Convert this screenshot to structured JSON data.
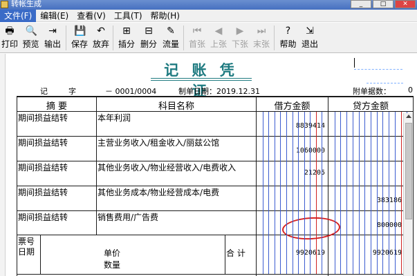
{
  "window": {
    "title": "转帐生成"
  },
  "menu": [
    "文件(F)",
    "编辑(E)",
    "查看(V)",
    "工具(T)",
    "帮助(H)"
  ],
  "toolbar": [
    {
      "label": "打印",
      "icon": "print-icon",
      "glyph": "🖶",
      "enabled": true
    },
    {
      "label": "预览",
      "icon": "preview-icon",
      "glyph": "🔍",
      "enabled": true
    },
    {
      "label": "输出",
      "icon": "export-icon",
      "glyph": "⇥",
      "enabled": true
    },
    {
      "label": "保存",
      "icon": "save-icon",
      "glyph": "💾",
      "enabled": true
    },
    {
      "label": "放弃",
      "icon": "undo-icon",
      "glyph": "↶",
      "enabled": true
    },
    {
      "label": "插分",
      "icon": "insert-entry-icon",
      "glyph": "⊞",
      "enabled": true
    },
    {
      "label": "删分",
      "icon": "delete-entry-icon",
      "glyph": "⊟",
      "enabled": true
    },
    {
      "label": "流量",
      "icon": "cashflow-icon",
      "glyph": "✎",
      "enabled": true
    },
    {
      "label": "首张",
      "icon": "first-icon",
      "glyph": "⏮",
      "enabled": false
    },
    {
      "label": "上张",
      "icon": "prev-icon",
      "glyph": "◀",
      "enabled": false
    },
    {
      "label": "下张",
      "icon": "next-icon",
      "glyph": "▶",
      "enabled": false
    },
    {
      "label": "末张",
      "icon": "last-icon",
      "glyph": "⏭",
      "enabled": false
    },
    {
      "label": "帮助",
      "icon": "help-icon",
      "glyph": "?",
      "enabled": true
    },
    {
      "label": "退出",
      "icon": "exit-icon",
      "glyph": "⇲",
      "enabled": true
    }
  ],
  "voucher": {
    "title": "记 账 凭 证",
    "type_label": "记",
    "type_char": "字",
    "number": "－ 0001/0004",
    "date_label": "制单日期：2019.12.31",
    "attachments_label": "附单据数：",
    "attachments_value": "0"
  },
  "table": {
    "headers": {
      "summary": "摘 要",
      "account": "科目名称",
      "debit": "借方金额",
      "credit": "贷方金额"
    },
    "rows": [
      {
        "summary": "期间损益结转",
        "account": "本年利润",
        "debit": "8839414",
        "credit": ""
      },
      {
        "summary": "期间损益结转",
        "account": "主营业务收入/租金收入/丽兹公馆",
        "debit": "1060000",
        "credit": ""
      },
      {
        "summary": "期间损益结转",
        "account": "其他业务收入/物业经营收入/电费收入",
        "debit": "21205",
        "credit": ""
      },
      {
        "summary": "期间损益结转",
        "account": "其他业务成本/物业经营成本/电费",
        "debit": "",
        "credit": "383186"
      },
      {
        "summary": "期间损益结转",
        "account": "销售费用/广告费",
        "debit": "",
        "credit": "800000"
      }
    ],
    "footer": {
      "ticket_label": "票号",
      "date_label": "日期",
      "price_label": "单价",
      "qty_label": "数量",
      "total_label": "合 计",
      "debit_total": "9920619",
      "credit_total": "9920619"
    }
  },
  "colors": {
    "title": "#1e7a80",
    "accent_line": "#3b5bd0",
    "highlight_circle": "#d42020"
  }
}
